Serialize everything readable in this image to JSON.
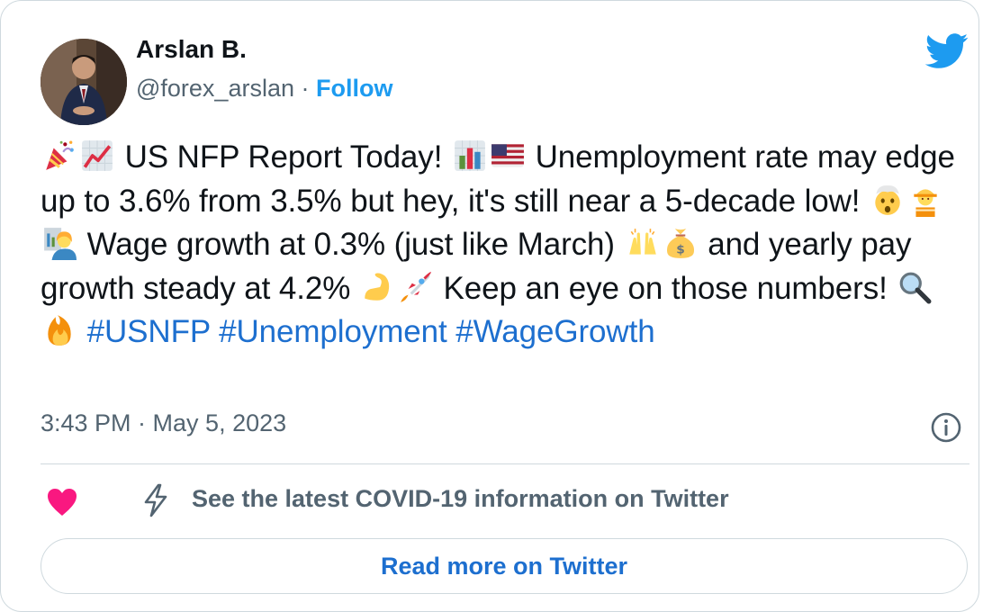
{
  "author": {
    "name": "Arslan B.",
    "handle": "@forex_arslan",
    "separator": "·",
    "follow_label": "Follow"
  },
  "tweet": {
    "seg1": "US NFP Report Today!",
    "seg2": "Unemployment rate may edge up to 3.6% from 3.5% but hey, it's still near a 5-decade low!",
    "seg3": "Wage growth at 0.3% (just like March)",
    "seg4": "and yearly pay growth steady at 4.2%",
    "seg5": "Keep an eye on those numbers!",
    "hashtags": [
      "#USNFP",
      "#Unemployment",
      "#WageGrowth"
    ]
  },
  "timestamp": "3:43 PM · May 5, 2023",
  "footer": {
    "covid_text": "See the latest COVID-19 information on Twitter",
    "read_more": "Read more on Twitter"
  },
  "colors": {
    "accent": "#1d9bf0",
    "link": "#1d6fcf",
    "heart": "#f91880",
    "muted": "#536471"
  }
}
